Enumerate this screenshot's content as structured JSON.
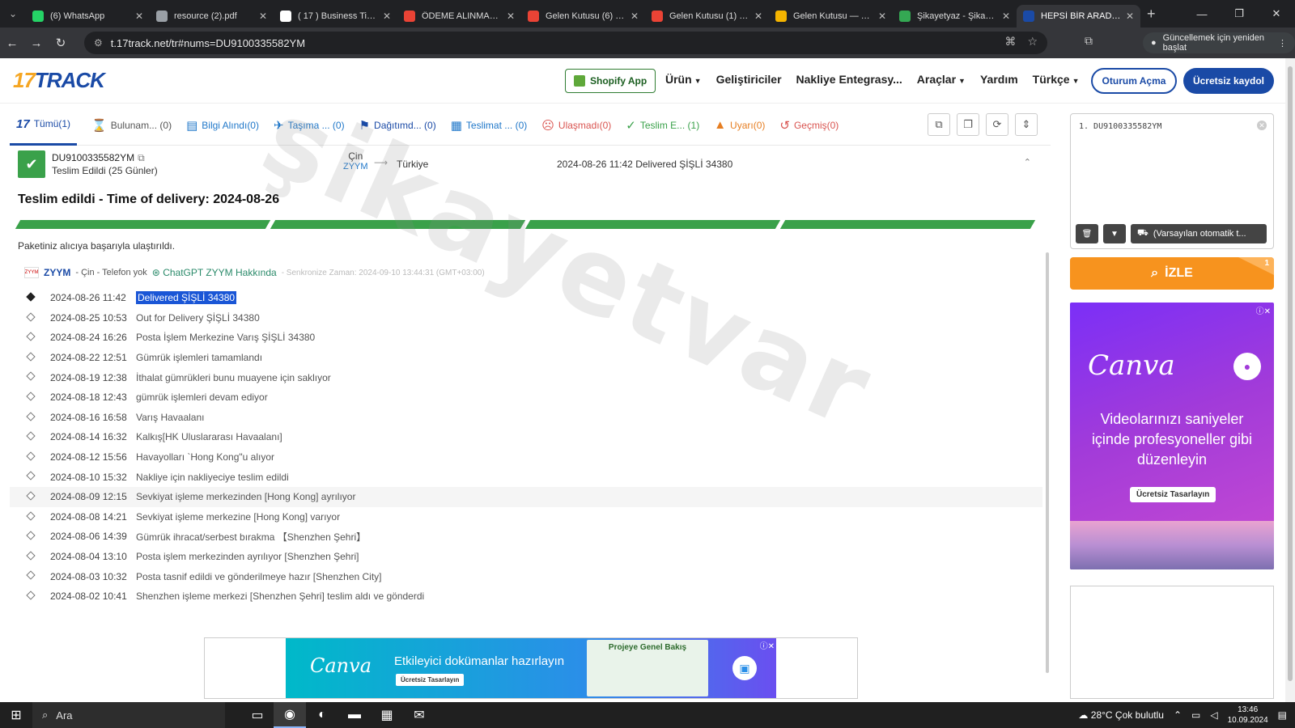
{
  "browser": {
    "tabs": [
      {
        "title": "(6) WhatsApp",
        "color": "#25d366",
        "active": false
      },
      {
        "title": "resource (2).pdf",
        "color": "#9aa0a6",
        "active": false
      },
      {
        "title": "( 17 ) Business Time -",
        "color": "#ffffff",
        "active": false
      },
      {
        "title": "ÖDEME ALINMADIĞI",
        "color": "#ea4335",
        "active": false
      },
      {
        "title": "Gelen Kutusu (6) - ku",
        "color": "#ea4335",
        "active": false
      },
      {
        "title": "Gelen Kutusu (1) - inf",
        "color": "#ea4335",
        "active": false
      },
      {
        "title": "Gelen Kutusu — Yand",
        "color": "#f4b400",
        "active": false
      },
      {
        "title": "Şikayetyaz - Şikayetv",
        "color": "#34a853",
        "active": false
      },
      {
        "title": "HEPSİ BİR ARADA PO",
        "color": "#1a4aa6",
        "active": true
      }
    ],
    "url": "t.17track.net/tr#nums=DU9100335582YM",
    "update_label": "Güncellemek için yeniden başlat"
  },
  "header": {
    "logo_num": "17",
    "logo_text": "TRACK",
    "shopify_label": "Shopify App",
    "nav": [
      {
        "label": "Ürün",
        "caret": true
      },
      {
        "label": "Geliştiriciler",
        "caret": false
      },
      {
        "label": "Nakliye Entegrasy...",
        "caret": false
      },
      {
        "label": "Araçlar",
        "caret": true
      },
      {
        "label": "Yardım",
        "caret": false
      },
      {
        "label": "Türkçe",
        "caret": true
      }
    ],
    "login_label": "Oturum Açma",
    "register_label": "Ücretsiz kaydol"
  },
  "filters": [
    {
      "icon": "17",
      "label": "Tümü(1)",
      "color": "navy",
      "name": "filter-all"
    },
    {
      "icon": "⌛",
      "label": "Bulunam... (0)",
      "color": "grey",
      "name": "filter-not-found"
    },
    {
      "icon": "▤",
      "label": "Bilgi Alındı(0)",
      "color": "blue",
      "name": "filter-info-received"
    },
    {
      "icon": "✈",
      "label": "Taşıma ... (0)",
      "color": "blue",
      "name": "filter-in-transit"
    },
    {
      "icon": "⚑",
      "label": "Dağıtımd... (0)",
      "color": "navy",
      "name": "filter-out-for-delivery"
    },
    {
      "icon": "▦",
      "label": "Teslimat ... (0)",
      "color": "blue",
      "name": "filter-delivery-failed"
    },
    {
      "icon": "☹",
      "label": "Ulaşmadı(0)",
      "color": "red",
      "name": "filter-undelivered"
    },
    {
      "icon": "✓",
      "label": "Teslim E... (1)",
      "color": "green",
      "name": "filter-delivered"
    },
    {
      "icon": "▲",
      "label": "Uyarı(0)",
      "color": "orange",
      "name": "filter-alert"
    },
    {
      "icon": "↺",
      "label": "Geçmiş(0)",
      "color": "red",
      "name": "filter-history"
    }
  ],
  "package": {
    "number": "DU9100335582YM",
    "status": "Teslim Edildi (25 Günler)",
    "origin": "Çin",
    "carrier": "ZYYM",
    "destination": "Türkiye",
    "last_event": "2024-08-26 11:42  Delivered ŞİŞLİ 34380",
    "delivery_title": "Teslim edildi - Time of delivery:  2024-08-26",
    "reached_text": "Paketiniz alıcıya başarıyla ulaştırıldı."
  },
  "carrier_info": {
    "logo_text": "ZYYM",
    "name": "ZYYM",
    "meta": "- Çin - Telefon yok",
    "chatgpt": "ChatGPT ZYYM Hakkında",
    "sync": "- Senkronize Zaman: 2024-09-10 13:44:31 (GMT+03:00)"
  },
  "events": [
    {
      "ts": "2024-08-26 11:42",
      "desc": "Delivered ŞİŞLİ 34380"
    },
    {
      "ts": "2024-08-25 10:53",
      "desc": "Out for Delivery ŞİŞLİ 34380"
    },
    {
      "ts": "2024-08-24 16:26",
      "desc": "Posta İşlem Merkezine Varış ŞİŞLİ 34380"
    },
    {
      "ts": "2024-08-22 12:51",
      "desc": "Gümrük işlemleri tamamlandı"
    },
    {
      "ts": "2024-08-19 12:38",
      "desc": "İthalat gümrükleri bunu muayene için saklıyor"
    },
    {
      "ts": "2024-08-18 12:43",
      "desc": "gümrük işlemleri devam ediyor"
    },
    {
      "ts": "2024-08-16 16:58",
      "desc": "Varış Havaalanı"
    },
    {
      "ts": "2024-08-14 16:32",
      "desc": "Kalkış[HK Uluslararası Havaalanı]"
    },
    {
      "ts": "2024-08-12 15:56",
      "desc": "Havayolları `Hong Kong\"u alıyor"
    },
    {
      "ts": "2024-08-10 15:32",
      "desc": "Nakliye için nakliyeciye teslim edildi"
    },
    {
      "ts": "2024-08-09 12:15",
      "desc": "Sevkiyat işleme merkezinden [Hong Kong] ayrılıyor"
    },
    {
      "ts": "2024-08-08 14:21",
      "desc": "Sevkiyat işleme merkezine [Hong Kong] varıyor"
    },
    {
      "ts": "2024-08-06 14:39",
      "desc": "Gümrük ihracat/serbest bırakma 【Shenzhen Şehri】"
    },
    {
      "ts": "2024-08-04 13:10",
      "desc": "Posta işlem merkezinden ayrılıyor [Shenzhen Şehri]"
    },
    {
      "ts": "2024-08-03 10:32",
      "desc": "Posta tasnif edildi ve gönderilmeye hazır [Shenzhen City]"
    },
    {
      "ts": "2024-08-02 10:41",
      "desc": "Shenzhen işleme merkezi [Shenzhen Şehri] teslim aldı ve gönderdi"
    }
  ],
  "watermark": "şikayetvar",
  "side": {
    "input_line": "1. DU9100335582YM",
    "carrier_select": "(Varsayılan otomatik t...",
    "track_label": "İZLE",
    "track_badge": "1"
  },
  "ad_side": {
    "brand": "Canva",
    "headline": "Videolarınızı saniyeler içinde profesyoneller gibi düzenleyin",
    "cta": "Ücretsiz Tasarlayın"
  },
  "ad_bottom": {
    "brand": "Canva",
    "headline": "Etkileyici dokümanlar hazırlayın",
    "cta": "Ücretsiz Tasarlayın",
    "doc_title": "Projeye Genel Bakış"
  },
  "taskbar": {
    "search_label": "Ara",
    "weather": "28°C  Çok bulutlu",
    "time": "13:46",
    "date": "10.09.2024"
  }
}
